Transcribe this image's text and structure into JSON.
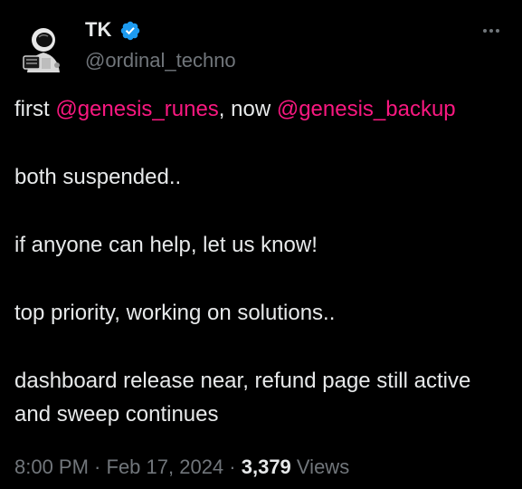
{
  "author": {
    "name": "TK",
    "handle": "@ordinal_techno",
    "verified": true
  },
  "tweet": {
    "line1": {
      "prefix": "first ",
      "mention1": "@genesis_runes",
      "middle": ", now ",
      "mention2": "@genesis_backup"
    },
    "para2": "both suspended..",
    "para3": "if anyone can help, let us know!",
    "para4": "top priority, working on solutions..",
    "para5": "dashboard release near, refund page still active and sweep continues"
  },
  "meta": {
    "time": "8:00 PM",
    "separator": " · ",
    "date": "Feb 17, 2024",
    "views_count": "3,379",
    "views_label": " Views"
  },
  "colors": {
    "background": "#000000",
    "text": "#e7e9ea",
    "secondary": "#71767b",
    "mention": "#f91880",
    "verified": "#1d9bf0"
  },
  "icons": {
    "verified": "verified-badge-icon",
    "more": "more-options-icon",
    "avatar": "astronaut-avatar"
  }
}
